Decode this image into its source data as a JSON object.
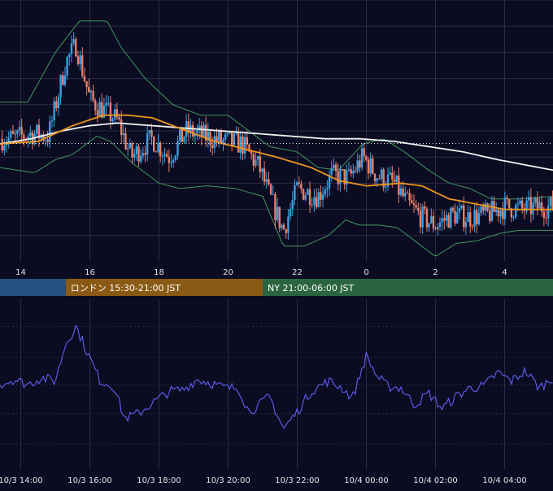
{
  "colors": {
    "background": "#0b0b22",
    "grid": "#2a2c44",
    "candle_up": "#3d9fe0",
    "candle_down": "#e8806a",
    "ma_short": "#f0961e",
    "ma_long": "#f2f2f2",
    "bollinger": "#3f9a5e",
    "oscillator": "#5a5ae6",
    "tick_text": "#e6e6e6",
    "session_tokyo": "#24507f",
    "session_london": "#8a5a14",
    "session_ny": "#2a6540"
  },
  "price_panel": {
    "x_tick_labels": [
      "14",
      "16",
      "18",
      "20",
      "22",
      "0",
      "2",
      "4"
    ],
    "reference_line_style": "dotted"
  },
  "session_bar": {
    "sessions": [
      {
        "label": ""
      },
      {
        "label": "ロンドン 15:30-21:00 JST"
      },
      {
        "label": "NY 21:00-06:00 JST"
      }
    ]
  },
  "oscillator_panel": {
    "x_tick_labels": [
      "10/3 14:00",
      "10/3 16:00",
      "10/3 18:00",
      "10/3 20:00",
      "10/3 22:00",
      "10/4 00:00",
      "10/4 02:00",
      "10/4 04:00"
    ]
  },
  "chart_data": [
    {
      "type": "candlestick",
      "x_unit": "hour (JST)",
      "x_ticks": [
        14,
        16,
        18,
        20,
        22,
        24,
        26,
        28
      ],
      "xlim": [
        13.4,
        29.4
      ],
      "ylim": [
        0,
        1
      ],
      "grid": true,
      "reference_level": 0.452,
      "close_anchors": [
        [
          13.4,
          0.47
        ],
        [
          13.8,
          0.47
        ],
        [
          14.3,
          0.49
        ],
        [
          14.8,
          0.48
        ],
        [
          15.3,
          0.76
        ],
        [
          15.6,
          0.83
        ],
        [
          16.0,
          0.62
        ],
        [
          16.4,
          0.58
        ],
        [
          16.8,
          0.54
        ],
        [
          17.2,
          0.4
        ],
        [
          17.8,
          0.47
        ],
        [
          18.3,
          0.4
        ],
        [
          18.8,
          0.5
        ],
        [
          19.3,
          0.48
        ],
        [
          19.8,
          0.46
        ],
        [
          20.4,
          0.45
        ],
        [
          20.9,
          0.36
        ],
        [
          21.2,
          0.25
        ],
        [
          21.6,
          0.12
        ],
        [
          22.0,
          0.28
        ],
        [
          22.6,
          0.25
        ],
        [
          23.0,
          0.33
        ],
        [
          23.5,
          0.32
        ],
        [
          23.9,
          0.4
        ],
        [
          24.3,
          0.33
        ],
        [
          24.8,
          0.3
        ],
        [
          25.2,
          0.22
        ],
        [
          25.6,
          0.17
        ],
        [
          26.0,
          0.14
        ],
        [
          26.5,
          0.18
        ],
        [
          27.0,
          0.17
        ],
        [
          27.5,
          0.18
        ],
        [
          28.0,
          0.21
        ],
        [
          28.5,
          0.2
        ],
        [
          29.0,
          0.21
        ],
        [
          29.4,
          0.21
        ]
      ],
      "ma_short_anchors": [
        [
          13.4,
          0.45
        ],
        [
          14.5,
          0.46
        ],
        [
          15.5,
          0.52
        ],
        [
          16.4,
          0.56
        ],
        [
          17.1,
          0.56
        ],
        [
          17.8,
          0.55
        ],
        [
          18.6,
          0.51
        ],
        [
          19.6,
          0.46
        ],
        [
          20.5,
          0.43
        ],
        [
          21.4,
          0.4
        ],
        [
          22.4,
          0.36
        ],
        [
          23.2,
          0.31
        ],
        [
          24.0,
          0.29
        ],
        [
          25.0,
          0.3
        ],
        [
          25.6,
          0.29
        ],
        [
          26.4,
          0.24
        ],
        [
          27.2,
          0.22
        ],
        [
          28.0,
          0.2
        ],
        [
          29.4,
          0.2
        ]
      ],
      "ma_long_anchors": [
        [
          13.4,
          0.45
        ],
        [
          14.3,
          0.47
        ],
        [
          15.2,
          0.5
        ],
        [
          16.0,
          0.52
        ],
        [
          16.8,
          0.53
        ],
        [
          17.8,
          0.52
        ],
        [
          18.8,
          0.51
        ],
        [
          19.8,
          0.5
        ],
        [
          20.8,
          0.49
        ],
        [
          21.8,
          0.48
        ],
        [
          22.8,
          0.47
        ],
        [
          23.8,
          0.47
        ],
        [
          24.8,
          0.46
        ],
        [
          25.8,
          0.44
        ],
        [
          26.8,
          0.42
        ],
        [
          27.8,
          0.39
        ],
        [
          28.6,
          0.37
        ],
        [
          29.4,
          0.35
        ]
      ],
      "bollinger_upper_anchors": [
        [
          13.4,
          0.61
        ],
        [
          14.2,
          0.61
        ],
        [
          15.0,
          0.8
        ],
        [
          15.7,
          0.92
        ],
        [
          16.5,
          0.92
        ],
        [
          16.9,
          0.82
        ],
        [
          17.6,
          0.7
        ],
        [
          18.4,
          0.6
        ],
        [
          19.2,
          0.56
        ],
        [
          20.0,
          0.56
        ],
        [
          20.6,
          0.5
        ],
        [
          21.2,
          0.44
        ],
        [
          22.0,
          0.42
        ],
        [
          22.6,
          0.36
        ],
        [
          23.2,
          0.35
        ],
        [
          23.9,
          0.45
        ],
        [
          24.5,
          0.47
        ],
        [
          25.1,
          0.42
        ],
        [
          25.8,
          0.35
        ],
        [
          26.4,
          0.3
        ],
        [
          27.0,
          0.28
        ],
        [
          27.6,
          0.24
        ],
        [
          28.4,
          0.24
        ],
        [
          29.4,
          0.25
        ]
      ],
      "bollinger_lower_anchors": [
        [
          13.4,
          0.36
        ],
        [
          14.4,
          0.34
        ],
        [
          15.0,
          0.39
        ],
        [
          15.5,
          0.41
        ],
        [
          16.2,
          0.48
        ],
        [
          16.6,
          0.46
        ],
        [
          17.2,
          0.38
        ],
        [
          18.0,
          0.3
        ],
        [
          18.6,
          0.28
        ],
        [
          19.4,
          0.29
        ],
        [
          20.2,
          0.28
        ],
        [
          21.0,
          0.25
        ],
        [
          21.6,
          0.06
        ],
        [
          22.2,
          0.06
        ],
        [
          22.9,
          0.1
        ],
        [
          23.4,
          0.16
        ],
        [
          23.8,
          0.14
        ],
        [
          24.4,
          0.14
        ],
        [
          24.9,
          0.13
        ],
        [
          25.4,
          0.08
        ],
        [
          26.0,
          0.02
        ],
        [
          26.6,
          0.07
        ],
        [
          27.2,
          0.08
        ],
        [
          27.9,
          0.11
        ],
        [
          28.4,
          0.12
        ],
        [
          29.4,
          0.12
        ]
      ]
    },
    {
      "type": "line",
      "x_unit": "hour (JST)",
      "xlim": [
        13.4,
        29.4
      ],
      "ylim": [
        0,
        1
      ],
      "grid": true,
      "reference_levels": [
        0.15,
        0.33,
        0.5,
        0.66,
        0.84
      ],
      "anchors": [
        [
          13.4,
          0.5
        ],
        [
          13.8,
          0.53
        ],
        [
          14.2,
          0.5
        ],
        [
          14.6,
          0.54
        ],
        [
          15.0,
          0.52
        ],
        [
          15.3,
          0.74
        ],
        [
          15.6,
          0.84
        ],
        [
          15.9,
          0.7
        ],
        [
          16.3,
          0.52
        ],
        [
          16.7,
          0.49
        ],
        [
          17.0,
          0.3
        ],
        [
          17.4,
          0.33
        ],
        [
          17.8,
          0.39
        ],
        [
          18.3,
          0.46
        ],
        [
          18.7,
          0.47
        ],
        [
          19.1,
          0.53
        ],
        [
          19.5,
          0.51
        ],
        [
          19.9,
          0.48
        ],
        [
          20.3,
          0.48
        ],
        [
          20.6,
          0.34
        ],
        [
          20.9,
          0.38
        ],
        [
          21.2,
          0.43
        ],
        [
          21.6,
          0.24
        ],
        [
          22.0,
          0.34
        ],
        [
          22.4,
          0.46
        ],
        [
          22.9,
          0.52
        ],
        [
          23.3,
          0.48
        ],
        [
          23.6,
          0.42
        ],
        [
          24.0,
          0.67
        ],
        [
          24.3,
          0.55
        ],
        [
          24.6,
          0.49
        ],
        [
          25.0,
          0.48
        ],
        [
          25.4,
          0.38
        ],
        [
          25.8,
          0.45
        ],
        [
          26.2,
          0.36
        ],
        [
          26.6,
          0.43
        ],
        [
          27.0,
          0.48
        ],
        [
          27.4,
          0.49
        ],
        [
          27.8,
          0.57
        ],
        [
          28.2,
          0.52
        ],
        [
          28.6,
          0.58
        ],
        [
          29.0,
          0.48
        ],
        [
          29.4,
          0.54
        ]
      ]
    }
  ]
}
